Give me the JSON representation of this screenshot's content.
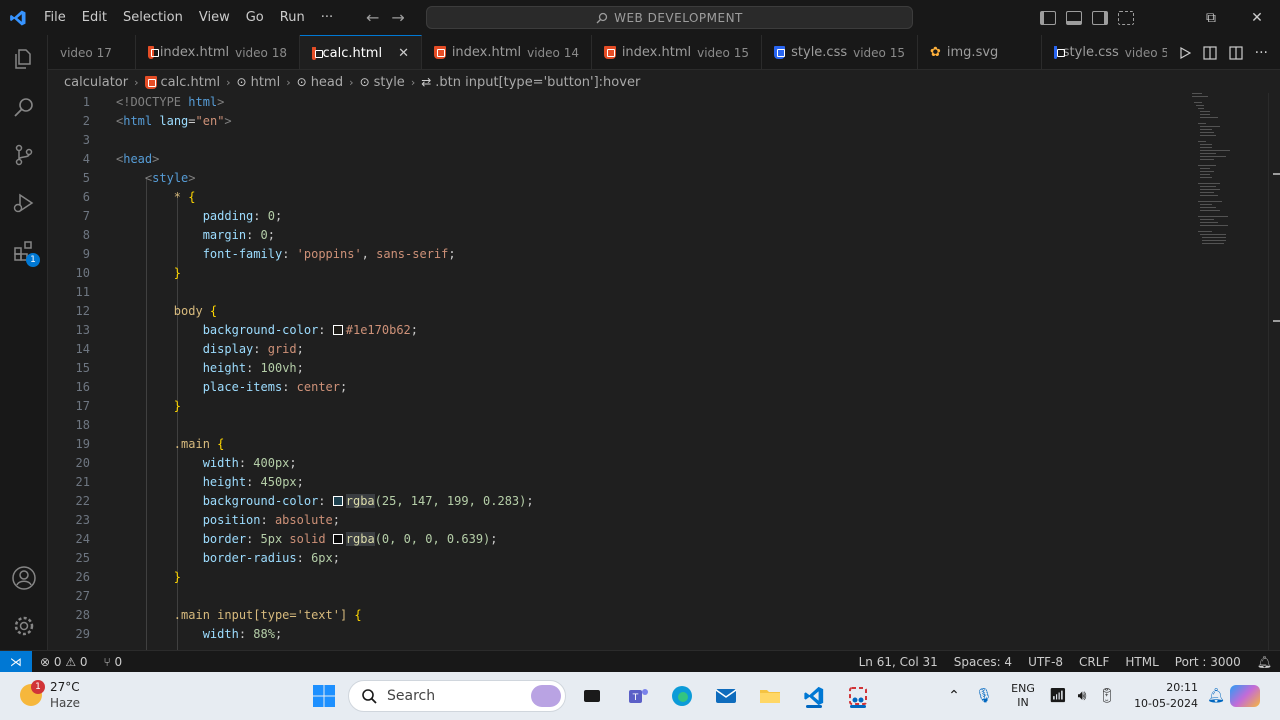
{
  "titlebar": {
    "menu": [
      "File",
      "Edit",
      "Selection",
      "View",
      "Go",
      "Run",
      "···"
    ],
    "command_center": "WEB DEVELOPMENT"
  },
  "activitybar": {
    "extensions_badge": "1"
  },
  "tabs": [
    {
      "label": "",
      "desc": "video 17",
      "icon": "none"
    },
    {
      "label": "index.html",
      "desc": "video 18",
      "icon": "html5-icon"
    },
    {
      "label": "calc.html",
      "desc": "",
      "icon": "html5-icon",
      "active": true
    },
    {
      "label": "index.html",
      "desc": "video 14",
      "icon": "html5-icon"
    },
    {
      "label": "index.html",
      "desc": "video 15",
      "icon": "html5-icon"
    },
    {
      "label": "style.css",
      "desc": "video 15",
      "icon": "css3-icon"
    },
    {
      "label": "img.svg",
      "desc": "",
      "icon": "svg-icon"
    },
    {
      "label": "style.css",
      "desc": "video 5",
      "icon": "css3-icon"
    }
  ],
  "tab_close": "✕",
  "breadcrumb": {
    "folder": "calculator",
    "file": "calc.html",
    "html": "html",
    "head": "head",
    "style": "style",
    "selector": ".btn input[type='button']:hover"
  },
  "code_lines": [
    {
      "n": "1"
    },
    {
      "n": "2"
    },
    {
      "n": "3"
    },
    {
      "n": "4"
    },
    {
      "n": "5"
    },
    {
      "n": "6"
    },
    {
      "n": "7"
    },
    {
      "n": "8"
    },
    {
      "n": "9"
    },
    {
      "n": "10"
    },
    {
      "n": "11"
    },
    {
      "n": "12"
    },
    {
      "n": "13"
    },
    {
      "n": "14"
    },
    {
      "n": "15"
    },
    {
      "n": "16"
    },
    {
      "n": "17"
    },
    {
      "n": "18"
    },
    {
      "n": "19"
    },
    {
      "n": "20"
    },
    {
      "n": "21"
    },
    {
      "n": "22"
    },
    {
      "n": "23"
    },
    {
      "n": "24"
    },
    {
      "n": "25"
    },
    {
      "n": "26"
    },
    {
      "n": "27"
    },
    {
      "n": "28"
    },
    {
      "n": "29"
    }
  ],
  "code": {
    "l1_a": "<!DOCTYPE ",
    "l1_b": "html",
    "l1_c": ">",
    "l2_a": "<",
    "l2_b": "html",
    "l2_c": "lang",
    "l2_d": "=",
    "l2_e": "\"en\"",
    "l2_f": ">",
    "l4_a": "<",
    "l4_b": "head",
    "l4_c": ">",
    "l5_a": "<",
    "l5_b": "style",
    "l5_c": ">",
    "l6_a": "* ",
    "l6_b": "{",
    "l7_a": "padding",
    "l7_b": ": ",
    "l7_c": "0",
    "l7_d": ";",
    "l8_a": "margin",
    "l8_b": ": ",
    "l8_c": "0",
    "l8_d": ";",
    "l9_a": "font-family",
    "l9_b": ": ",
    "l9_c": "'poppins'",
    "l9_d": ", ",
    "l9_e": "sans-serif",
    "l9_f": ";",
    "l10_a": "}",
    "l12_a": "body ",
    "l12_b": "{",
    "l13_a": "background-color",
    "l13_b": ": ",
    "l13_c": "#1e170b62",
    "l13_d": ";",
    "l14_a": "display",
    "l14_b": ": ",
    "l14_c": "grid",
    "l14_d": ";",
    "l15_a": "height",
    "l15_b": ": ",
    "l15_c": "100vh",
    "l15_d": ";",
    "l16_a": "place-items",
    "l16_b": ": ",
    "l16_c": "center",
    "l16_d": ";",
    "l17_a": "}",
    "l19_a": ".main ",
    "l19_b": "{",
    "l20_a": "width",
    "l20_b": ": ",
    "l20_c": "400px",
    "l20_d": ";",
    "l21_a": "height",
    "l21_b": ": ",
    "l21_c": "450px",
    "l21_d": ";",
    "l22_a": "background-color",
    "l22_b": ": ",
    "l22_c": "rgba",
    "l22_d": "(25, 147, 199, 0.283)",
    "l22_e": ";",
    "l23_a": "position",
    "l23_b": ": ",
    "l23_c": "absolute",
    "l23_d": ";",
    "l24_a": "border",
    "l24_b": ": ",
    "l24_c": "5px ",
    "l24_d": "solid ",
    "l24_e": "rgba",
    "l24_f": "(0, 0, 0, 0.639)",
    "l24_g": ";",
    "l25_a": "border-radius",
    "l25_b": ": ",
    "l25_c": "6px",
    "l25_d": ";",
    "l26_a": "}",
    "l28_a": ".main input[type='text'] ",
    "l28_b": "{",
    "l29_a": "width",
    "l29_b": ": ",
    "l29_c": "88%",
    "l29_d": ";"
  },
  "swatch_colors": {
    "body_bg": "#1e170b62",
    "main_bg": "rgba(25,147,199,0.283)",
    "main_border": "rgba(0,0,0,0.639)"
  },
  "statusbar": {
    "remote_icon": "remote-icon",
    "problems": "⊗ 0 ⚠ 0",
    "ports": "⑂ 0",
    "position": "Ln 61, Col 31",
    "spaces": "Spaces: 4",
    "encoding": "UTF-8",
    "eol": "CRLF",
    "language": "HTML",
    "port": "Port : 3000"
  },
  "taskbar": {
    "weather_badge": "1",
    "temp": "27°C",
    "condition": "Haze",
    "search": "Search",
    "lang_line1": "ENG",
    "lang_line2": "IN",
    "time": "20:11",
    "date": "10-05-2024"
  },
  "colors": {
    "accent": "#0078d4",
    "editor_bg": "#1f1f1f",
    "chrome_bg": "#181818"
  }
}
